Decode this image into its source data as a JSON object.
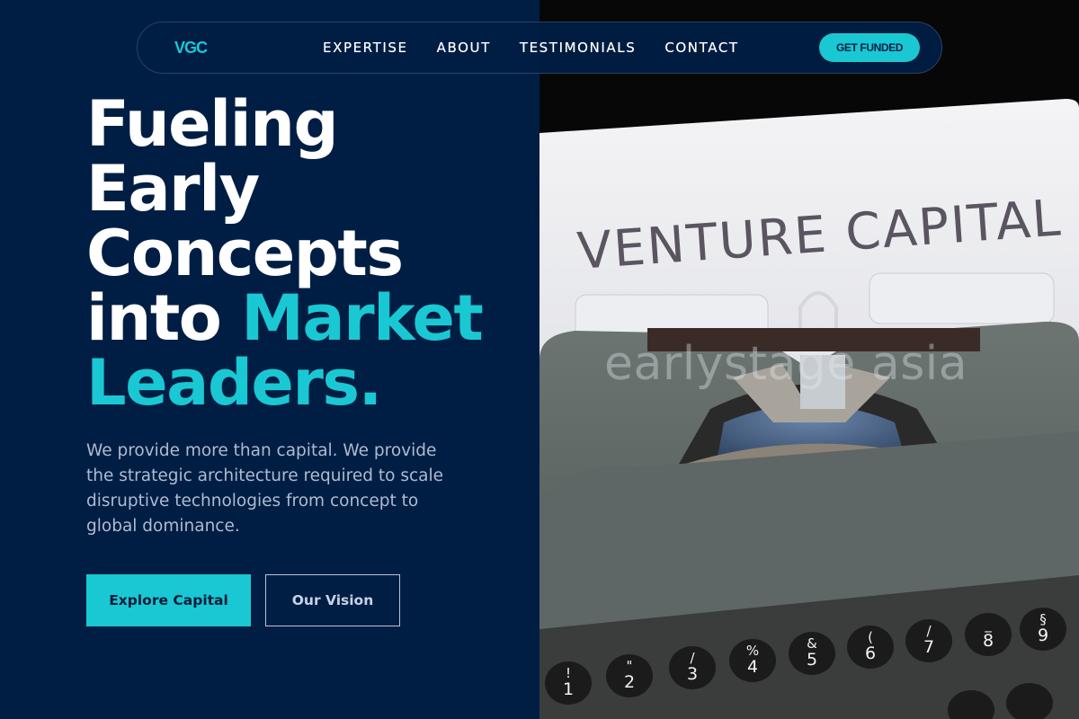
{
  "nav": {
    "logo": "VGC",
    "links": [
      "EXPERTISE",
      "ABOUT",
      "TESTIMONIALS",
      "CONTACT"
    ],
    "cta_label": "GET FUNDED"
  },
  "hero": {
    "title_lines": [
      "Fueling",
      "Early",
      "Concepts",
      "into"
    ],
    "title_accent_1": "Market",
    "title_accent_2": "Leaders.",
    "description": "We provide more than capital. We provide the strategic architecture required to scale disruptive technologies from concept to global dominance.",
    "primary_button": "Explore Capital",
    "secondary_button": "Our Vision"
  },
  "image": {
    "paper_text": "VENTURE CAPITAL",
    "watermark": "earlystage asia",
    "keys": [
      "1",
      "2",
      "3",
      "4",
      "5",
      "6",
      "7",
      "8",
      "9"
    ],
    "key_symbols": [
      "!",
      "\"",
      "/",
      "%",
      "&",
      "(",
      "/",
      "_",
      "§"
    ]
  },
  "colors": {
    "background": "#001e44",
    "accent": "#19c8d2",
    "text": "#ffffff",
    "muted_text": "#aebbd0"
  }
}
